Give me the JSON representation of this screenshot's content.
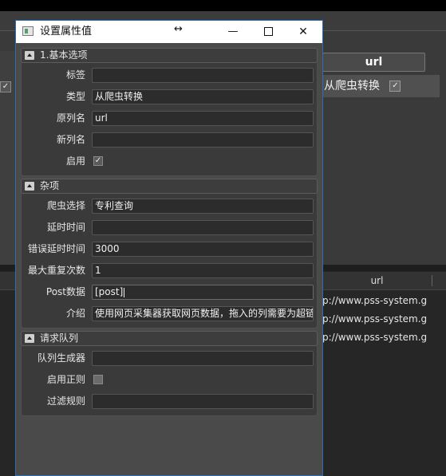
{
  "background": {
    "column_header": "url",
    "row_cell": "从爬虫转换",
    "left_check": "✓",
    "row_check": "✓",
    "lower_header": "url",
    "list_rows": [
      "p://www.pss-system.g",
      "p://www.pss-system.g",
      "p://www.pss-system.g"
    ]
  },
  "dialog": {
    "title": "设置属性值",
    "resize_glyph": "↔",
    "minimize_glyph": "—",
    "close_glyph": "✕",
    "sections": {
      "basic": {
        "title": "1.基本选项",
        "tag_label": "标签",
        "tag_value": "",
        "type_label": "类型",
        "type_value": "从爬虫转换",
        "orig_col_label": "原列名",
        "orig_col_value": "url",
        "new_col_label": "新列名",
        "new_col_value": "",
        "enable_label": "启用",
        "enable_checked": "✓"
      },
      "misc": {
        "title": "杂项",
        "crawler_label": "爬虫选择",
        "crawler_value": "专利查询",
        "delay_label": "延时时间",
        "delay_value": "",
        "error_delay_label": "错误延时时间",
        "error_delay_value": "3000",
        "max_retry_label": "最大重复次数",
        "max_retry_value": "1",
        "post_label": "Post数据",
        "post_value": "[post]",
        "intro_label": "介绍",
        "intro_value": "使用网页采集器获取网页数据，拖入的列需要为超链接"
      },
      "queue": {
        "title": "请求队列",
        "generator_label": "队列生成器",
        "generator_value": "",
        "regex_label": "启用正则",
        "regex_checked": "",
        "filter_label": "过滤规则",
        "filter_value": ""
      }
    }
  }
}
